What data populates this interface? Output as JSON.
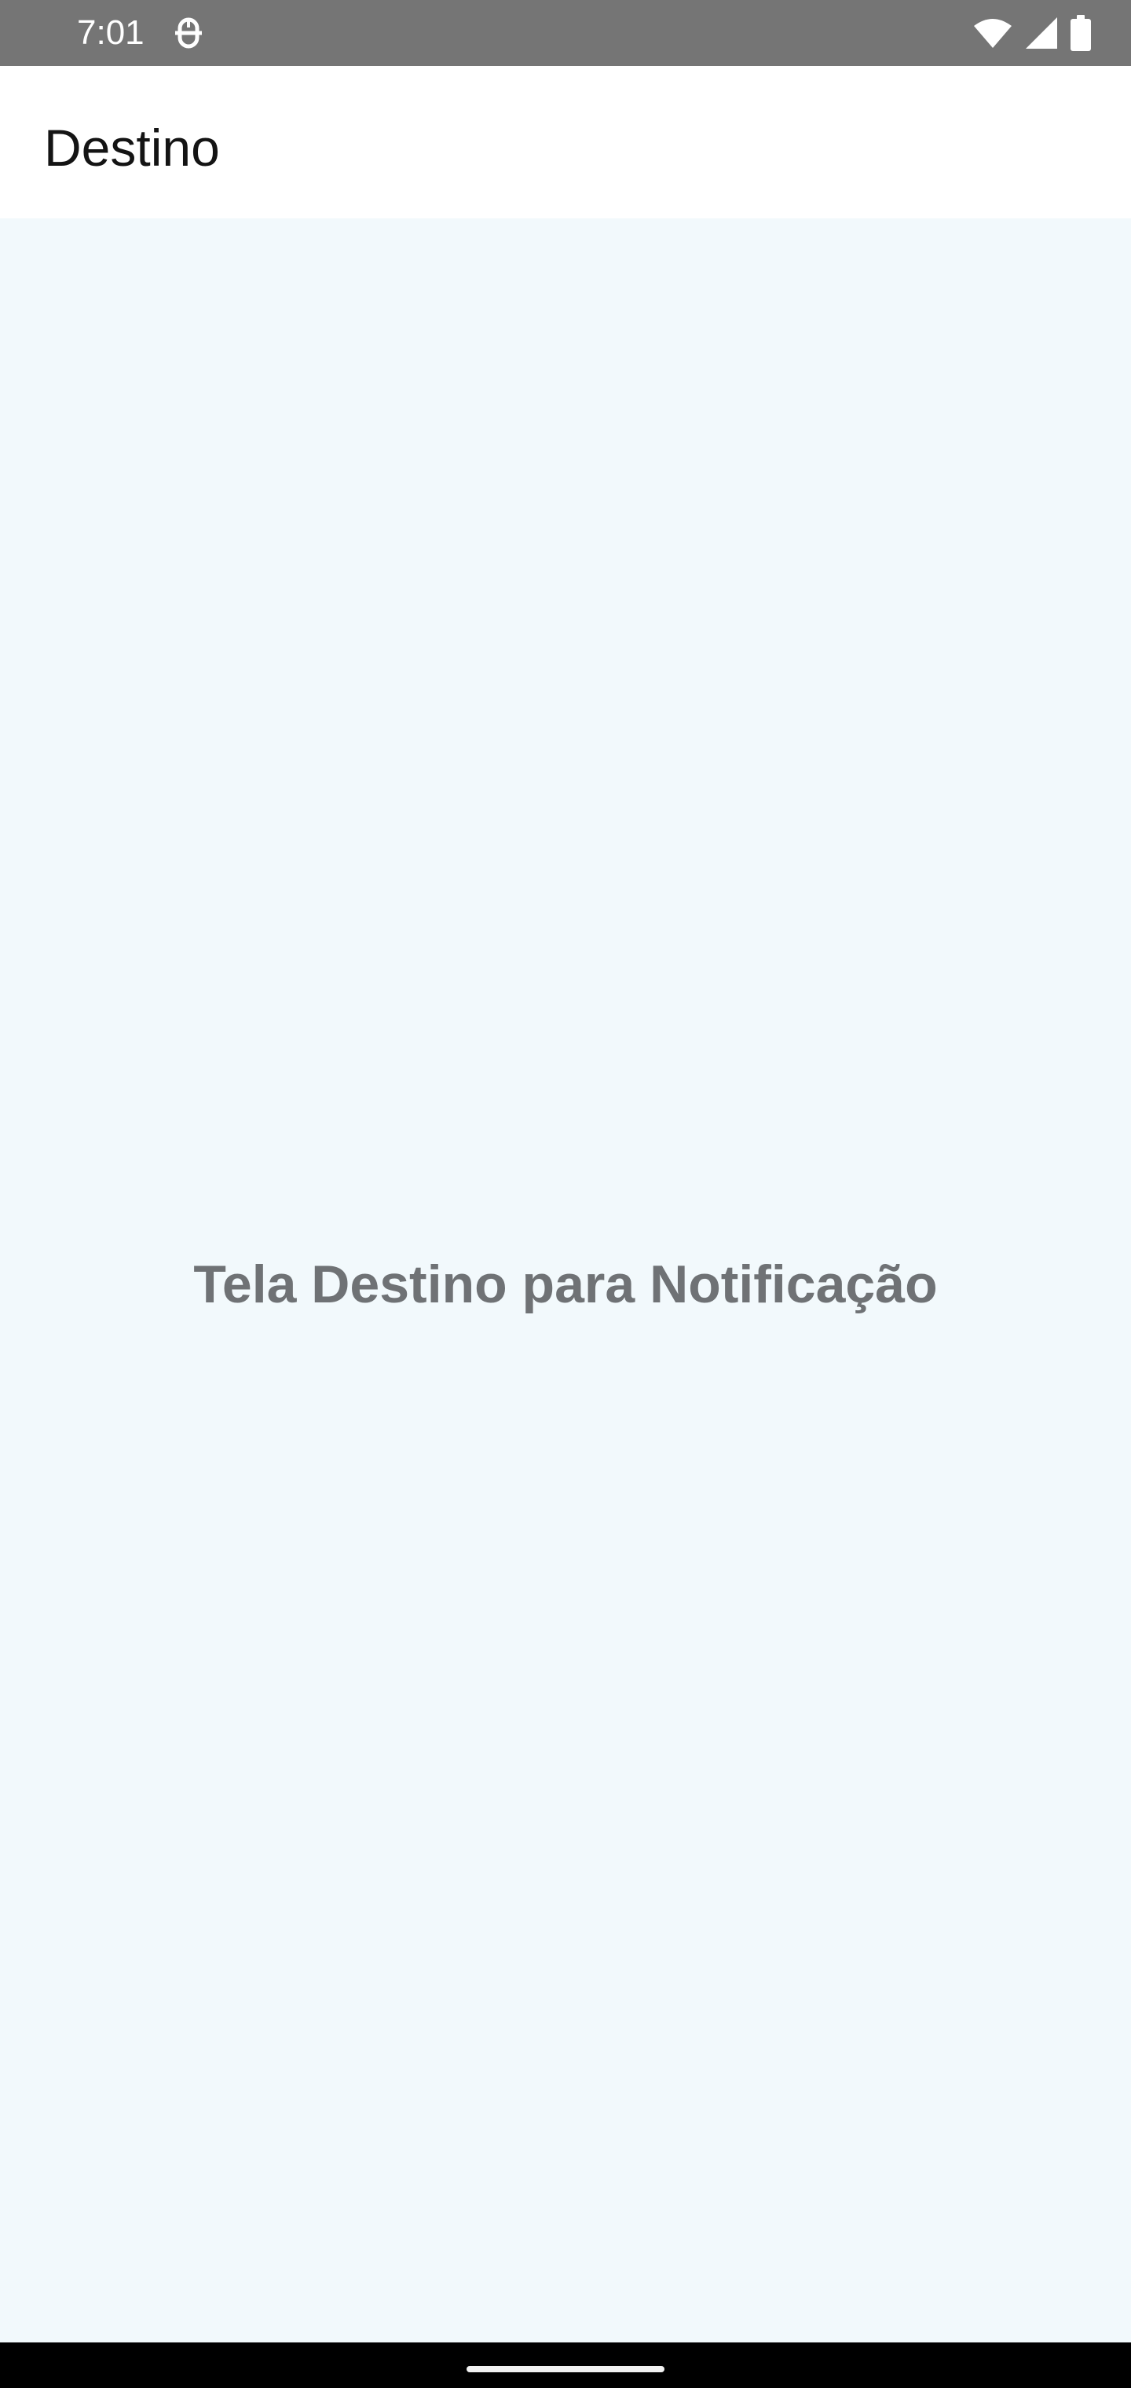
{
  "status_bar": {
    "time": "7:01",
    "background_color": "#757575",
    "icons": [
      "notification-icon",
      "wifi-icon",
      "signal-icon",
      "battery-icon"
    ]
  },
  "app_bar": {
    "title": "Destino"
  },
  "content": {
    "message": "Tela Destino para Notificação",
    "background_color": "#f2f9fc"
  },
  "nav_bar": {
    "icons": [
      "home-handle"
    ]
  }
}
